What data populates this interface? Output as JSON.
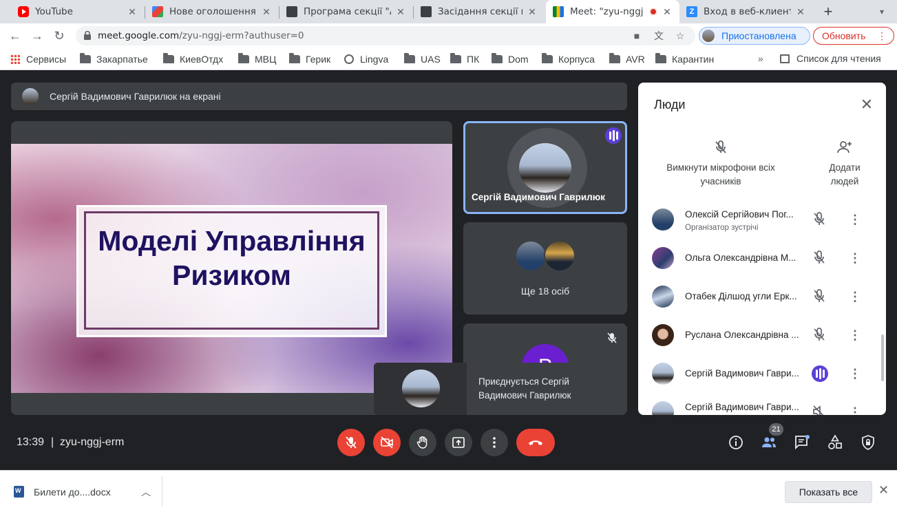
{
  "browser": {
    "tabs": [
      {
        "title": "YouTube",
        "favicon_color": "#ff0000",
        "active": false
      },
      {
        "title": "Нове оголошення",
        "favicon_color": "#ea4335",
        "active": false
      },
      {
        "title": "Програма секції \"А",
        "favicon_color": "#3c4043",
        "active": false
      },
      {
        "title": "Засідання секції ко",
        "favicon_color": "#3c4043",
        "active": false
      },
      {
        "title": "Meet: \"zyu-nggj",
        "favicon_color": "#00897b",
        "active": true
      },
      {
        "title": "Вход в веб-клиент",
        "favicon_color": "#2d8cff",
        "active": false
      }
    ],
    "url_host": "meet.google.com",
    "url_path": "/zyu-nggj-erm?authuser=0",
    "profile_status": "Приостановлена",
    "update_label": "Обновить",
    "bookmarks": [
      "Сервисы",
      "Закарпатье",
      "КиевОтдх",
      "МВЦ",
      "Герик",
      "Lingva",
      "UAS",
      "ПК",
      "Dom",
      "Корпуса",
      "AVR",
      "Карантин"
    ],
    "more_bookmarks": "»",
    "reading_list": "Список для чтения"
  },
  "meet": {
    "presenting_banner": "Сергій Вадимович Гаврилюк на екрані",
    "slide_title_line1": "Моделі Управління",
    "slide_title_line2": "Ризиком",
    "tile_main_name": "Сергій Вадимович Гаврилюк",
    "tile_more": "Ще 18 осіб",
    "tile3_initial": "Р",
    "toast_text": "Приєднується Сергій Вадимович Гаврилюк",
    "time": "13:39",
    "separator": "|",
    "meeting_code": "zyu-nggj-erm",
    "participant_count": "21",
    "accent_color": "#5c3fd6",
    "danger_color": "#ea4335"
  },
  "people_panel": {
    "title": "Люди",
    "mute_all_line1": "Вимкнути мікрофони всіх",
    "mute_all_line2": "учасників",
    "add_people_line1": "Додати",
    "add_people_line2": "людей",
    "participants": [
      {
        "name": "Олексій Сергійович Пог...",
        "role": "Організатор зустрічі",
        "status": "muted"
      },
      {
        "name": "Ольга Олександрівна М...",
        "role": "",
        "status": "muted"
      },
      {
        "name": "Отабек Ділшод угли Ерк...",
        "role": "",
        "status": "muted"
      },
      {
        "name": "Руслана Олександрівна ...",
        "role": "",
        "status": "muted"
      },
      {
        "name": "Сергій Вадимович Гаври...",
        "role": "",
        "status": "speaking"
      },
      {
        "name": "Сергій Вадимович Гаври...",
        "role": "",
        "status": "muted"
      }
    ]
  },
  "downloads": {
    "file": "Билети до....docx",
    "show_all": "Показать все"
  }
}
